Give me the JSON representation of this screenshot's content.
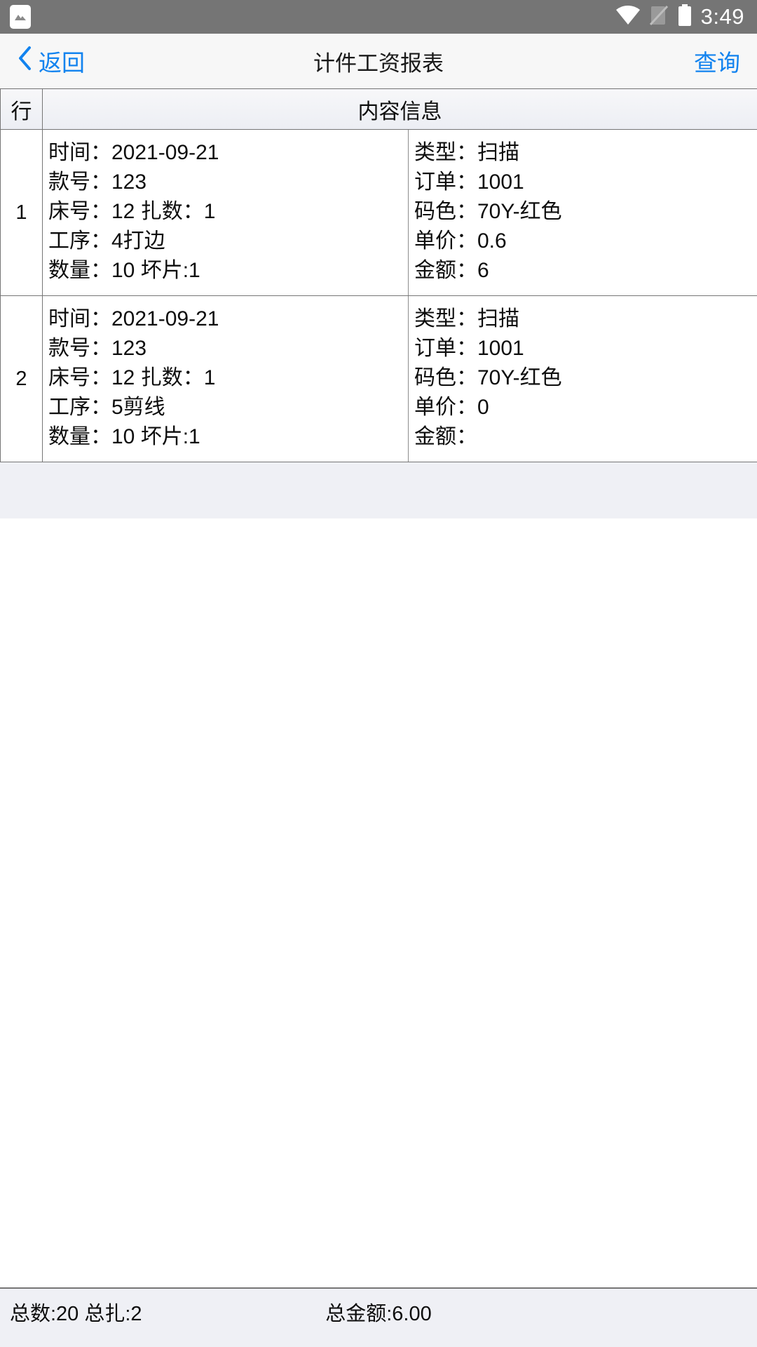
{
  "status_bar": {
    "notification_icon": "photo-icon",
    "wifi_icon": "wifi-icon",
    "signal_icon": "signal-off-icon",
    "battery_icon": "battery-icon",
    "time": "3:49",
    "background_color": "#757575"
  },
  "nav_bar": {
    "back_icon": "chevron-left-icon",
    "back_label": "返回",
    "title": "计件工资报表",
    "action_label": "查询",
    "accent_color": "#1283ef",
    "background_color": "#f7f7f7"
  },
  "table": {
    "headers": {
      "index": "行",
      "content": "内容信息"
    },
    "rows": [
      {
        "index": "1",
        "left": [
          "时间：2021-09-21",
          "款号：123",
          "床号：12 扎数：1",
          "工序：4打边",
          "数量：10 坏片:1"
        ],
        "right": [
          "类型：扫描",
          "订单：1001",
          "码色：70Y-红色",
          "单价：0.6",
          "金额：6"
        ]
      },
      {
        "index": "2",
        "left": [
          "时间：2021-09-21",
          "款号：123",
          "床号：12 扎数：1",
          "工序：5剪线",
          "数量：10 坏片:1"
        ],
        "right": [
          "类型：扫描",
          "订单：1001",
          "码色：70Y-红色",
          "单价：0",
          "金额："
        ]
      }
    ]
  },
  "summary_bar": {
    "counts": "总数:20 总扎:2",
    "total_amount": "总金额:6.00",
    "background_color": "#eff0f5"
  }
}
